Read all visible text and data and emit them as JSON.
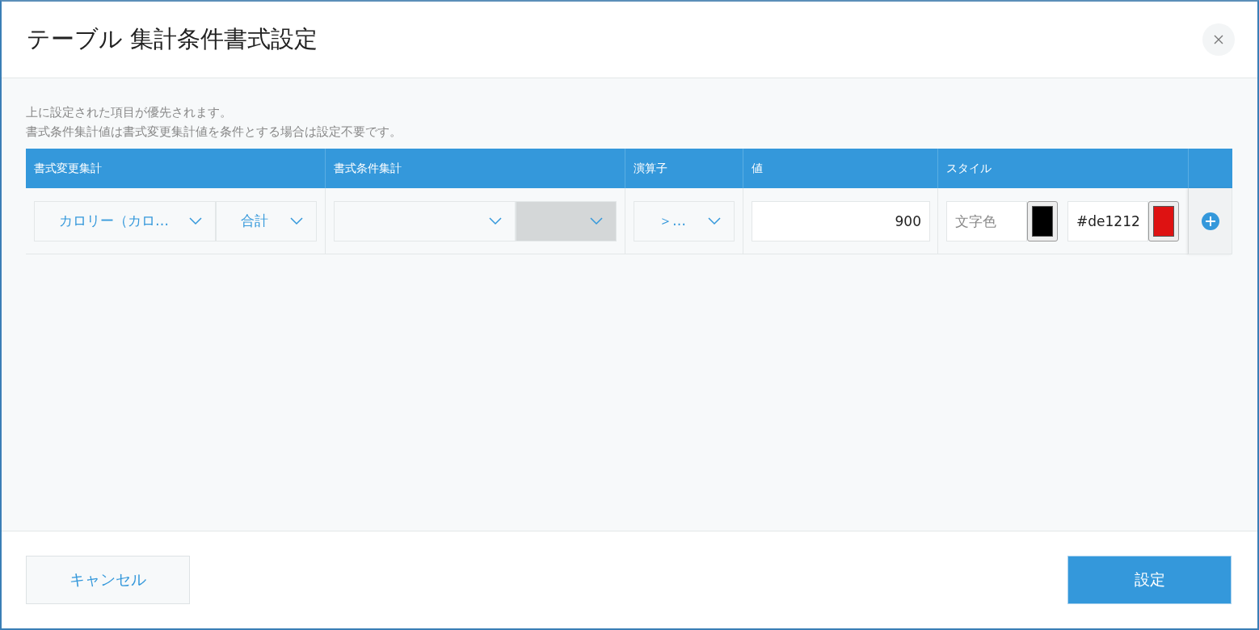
{
  "dialog": {
    "title": "テーブル 集計条件書式設定",
    "notes": [
      "上に設定された項目が優先されます。",
      "書式条件集計値は書式変更集計値を条件とする場合は設定不要です。"
    ],
    "table": {
      "columns": [
        "書式変更集計",
        "書式条件集計",
        "演算子",
        "値",
        "スタイル"
      ],
      "rows": [
        {
          "change_aggregate": [
            {
              "text": "カロリー（カロ…",
              "disabled": false
            },
            {
              "text": "合計",
              "disabled": false
            }
          ],
          "condition_aggregate": [
            {
              "disabled": false
            },
            {
              "disabled": true
            }
          ],
          "operator": {
            "text": "＞…",
            "disabled": false
          },
          "value": "900",
          "style": [
            {
              "placeholder": "文字色",
              "color": "#000000"
            },
            {
              "value": "#de1212",
              "color": "#de1212"
            }
          ]
        }
      ]
    },
    "buttons": [
      {
        "label": "キャンセル",
        "kind": "secondary"
      },
      {
        "label": "設定",
        "kind": "primary"
      }
    ]
  }
}
